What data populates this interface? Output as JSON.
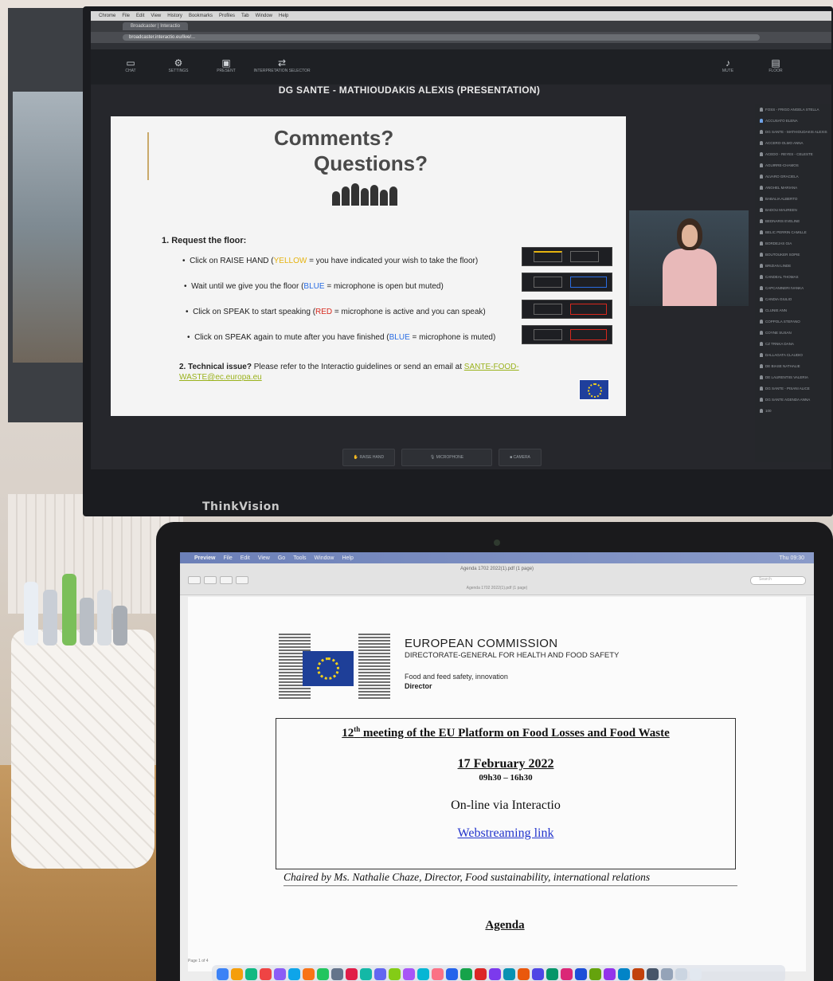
{
  "monitor": {
    "brand": "ThinkVision",
    "browser": {
      "menu_items": [
        "Chrome",
        "File",
        "Edit",
        "View",
        "History",
        "Bookmarks",
        "Profiles",
        "Tab",
        "Window",
        "Help"
      ],
      "tab_label": "Broadcaster | Interactio",
      "url": "broadcaster.interactio.eu/live/..."
    },
    "toolbar": {
      "items": [
        "CHAT",
        "SETTINGS",
        "PRESENT",
        "INTERPRETATION SELECTOR",
        "MUTE",
        "FLOOR"
      ]
    },
    "stream_title": "DG SANTE - MATHIOUDAKIS ALEXIS (PRESENTATION)",
    "slide": {
      "heading_1": "Comments?",
      "heading_2": "Questions?",
      "step1_title": "1. Request the floor:",
      "bullets": [
        {
          "pre": "Click on RAISE HAND (",
          "hl": "YELLOW",
          "post": " = you have indicated your wish to take the floor)",
          "color": "yellow"
        },
        {
          "pre": "Wait until we give you the floor (",
          "hl": "BLUE",
          "post": " = microphone is open but muted)",
          "color": "blue"
        },
        {
          "pre": "Click on SPEAK to start speaking  (",
          "hl": "RED",
          "post": " = microphone is active and you can speak)",
          "color": "red"
        },
        {
          "pre": "Click on SPEAK again to mute after you have finished (",
          "hl": "BLUE",
          "post": " = microphone is muted)",
          "color": "blue"
        }
      ],
      "step2_bold": "2. Technical issue?",
      "step2_text": " Please refer to the Interactio guidelines or send an email at ",
      "step2_email": "SANTE-FOOD-WASTE@ec.europa.eu"
    },
    "participants": [
      "FOSS - FRIGO ANGELA STELLA",
      "ACCUSATO ELENA",
      "DG SANTE - MATHIOUDAKIS ALEXIS",
      "ACCERO-OLMO ANNA",
      "ACEDO - REYES - CELESTE",
      "AGUIRRE-CHAMOS",
      "ALVARO GRACIELA",
      "ANGHEL MARIANA",
      "BABALIA ALBERTO",
      "BADOU MAUREEN",
      "BEDNARIS EVELINE",
      "BELIC PERRIN CAMILLE",
      "BORDEJAS GIA",
      "BOUTOUKER SOPIE",
      "BRIZIAN LINDE",
      "CANDEAL THOMAS",
      "CAPCANINERI IVANKA",
      "CANDIA GIULIO",
      "CLUNIE ANN",
      "COPPOLA STEFANO",
      "COYNE SUSAN",
      "CZ TRNKA DANA",
      "DALLAGATA CLAUDIO",
      "DE BIASE NATHALIE",
      "DE LAURENTIIS VALERIA",
      "DG SANTE - PISANI ALICE",
      "DG SANTE AGENDA ANNA",
      "100"
    ],
    "bottom_controls": [
      "RAISE HAND",
      "MICROPHONE",
      "CAMERA"
    ]
  },
  "laptop": {
    "menubar": {
      "items": [
        "Preview",
        "File",
        "Edit",
        "View",
        "Go",
        "Tools",
        "Window",
        "Help"
      ],
      "clock": "Thu 09:30"
    },
    "window_title": "Agenda 1702 2022(1).pdf (1 page)",
    "window_subtitle": "Agenda 1702 2022(1).pdf (1 page)",
    "search_placeholder": "Search",
    "document": {
      "org": "EUROPEAN COMMISSION",
      "dg": "DIRECTORATE-GENERAL FOR HEALTH AND FOOD SAFETY",
      "unit": "Food and feed safety, innovation",
      "role": "Director",
      "meeting_ordinal": "12",
      "meeting_ordinal_suffix": "th",
      "meeting_title_rest": " meeting of the EU Platform on Food Losses and Food Waste",
      "date": "17 February 2022",
      "time": "09h30 – 16h30",
      "venue": "On-line via Interactio",
      "link": "Webstreaming link",
      "chair": "Chaired by Ms. Nathalie Chaze, Director, Food sustainability, international relations",
      "agenda": "Agenda"
    },
    "status": "Page 1 of 4"
  },
  "colors": {
    "yellow": "#e5b30f",
    "blue": "#2b6de3",
    "red": "#d6281d",
    "eu_blue": "#1e3f98",
    "eu_gold": "#f3d11c"
  }
}
